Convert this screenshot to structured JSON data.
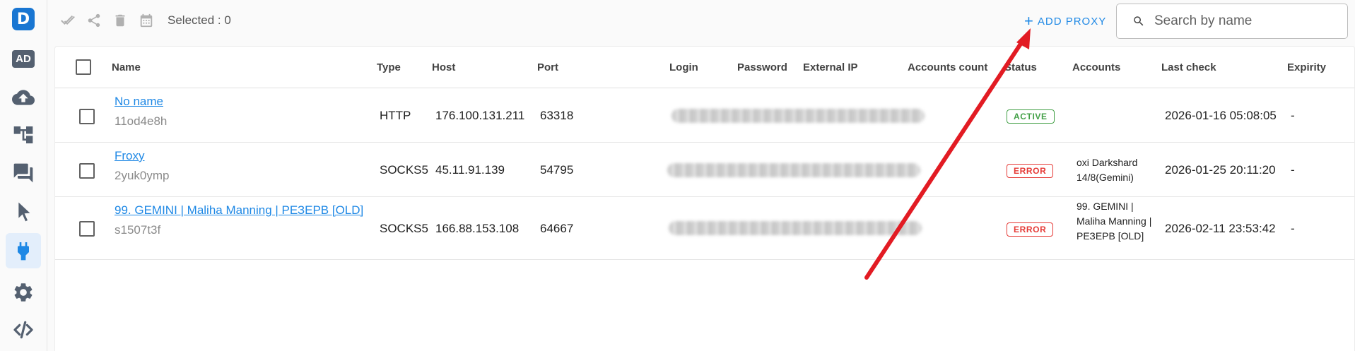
{
  "sidebar": {
    "logo_letter": "D",
    "ad_label": "AD",
    "items": [
      {
        "icon": "cloud-upload-icon"
      },
      {
        "icon": "hierarchy-icon"
      },
      {
        "icon": "chat-icon"
      },
      {
        "icon": "cursor-icon"
      },
      {
        "icon": "plug-icon",
        "active": true
      },
      {
        "icon": "gear-icon"
      },
      {
        "icon": "code-icon"
      }
    ]
  },
  "toolbar": {
    "selected_label": "Selected : 0",
    "add_proxy_plus": "+",
    "add_proxy_label": "ADD PROXY",
    "search_placeholder": "Search by name"
  },
  "table": {
    "headers": {
      "name": "Name",
      "type": "Type",
      "host": "Host",
      "port": "Port",
      "login": "Login",
      "password": "Password",
      "external_ip": "External IP",
      "accounts_count": "Accounts count",
      "status": "Status",
      "accounts": "Accounts",
      "last_check": "Last check",
      "expirity": "Expirity"
    },
    "rows": [
      {
        "name": "No name",
        "id": "11od4e8h",
        "type": "HTTP",
        "host": "176.100.131.211",
        "port": "63318",
        "status": "ACTIVE",
        "accounts": "",
        "last_check": "2026-01-16 05:08:05",
        "expirity": "-"
      },
      {
        "name": "Froxy",
        "id": "2yuk0ymp",
        "type": "SOCKS5",
        "host": "45.11.91.139",
        "port": "54795",
        "status": "ERROR",
        "accounts": "oxi Darkshard 14/8(Gemini)",
        "last_check": "2026-01-25 20:11:20",
        "expirity": "-"
      },
      {
        "name": "99. GEMINI | Maliha Manning | РЕЗЕРВ [OLD]",
        "id": "s1507t3f",
        "type": "SOCKS5",
        "host": "166.88.153.108",
        "port": "64667",
        "status": "ERROR",
        "accounts": "99. GEMINI | Maliha Manning | РЕЗЕРВ [OLD]",
        "last_check": "2026-02-11 23:53:42",
        "expirity": "-"
      }
    ]
  },
  "colors": {
    "accent": "#1e88e5",
    "active": "#43a047",
    "error": "#e53935",
    "arrow": "#e21b23"
  }
}
